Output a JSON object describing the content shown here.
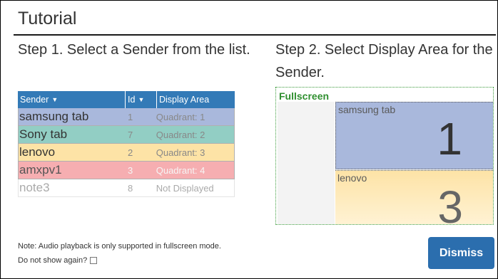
{
  "dialog": {
    "title": "Tutorial",
    "step1": "Step 1. Select a Sender from the list.",
    "step2": "Step 2. Select Display Area for the Sender.",
    "note": "Note: Audio playback is only supported in fullscreen mode.",
    "do_not_show": "Do not show again?",
    "dismiss_label": "Dismiss"
  },
  "table": {
    "headers": {
      "sender": "Sender",
      "id": "Id",
      "area": "Display Area"
    },
    "rows": [
      {
        "sender": "samsung tab",
        "id": "1",
        "area": "Quadrant: 1"
      },
      {
        "sender": "Sony tab",
        "id": "7",
        "area": "Quadrant: 2"
      },
      {
        "sender": "lenovo",
        "id": "2",
        "area": "Quadrant: 3"
      },
      {
        "sender": "amxpv1",
        "id": "3",
        "area": "Quadrant: 4"
      },
      {
        "sender": "note3",
        "id": "8",
        "area": "Not Displayed"
      }
    ]
  },
  "display": {
    "fullscreen_label": "Fullscreen",
    "quadrants": [
      {
        "name": "samsung tab",
        "number": "1"
      },
      {
        "name": "lenovo",
        "number": "3"
      }
    ]
  },
  "colors": {
    "header": "#337ab7",
    "quadrant1": "#a9b8dc",
    "quadrant2": "#92cec4",
    "quadrant3": "#fde3a6",
    "quadrant4": "#f6aeb1",
    "button": "#2b6eae"
  }
}
